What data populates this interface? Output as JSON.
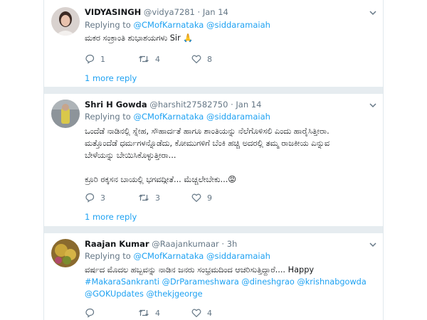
{
  "tweets": [
    {
      "name": "VIDYASINGH",
      "handle": "@vidya7281",
      "dot": "·",
      "time": "Jan 14",
      "replying_label": "Replying to",
      "mention1": "@CMofKarnataka",
      "mention2": "@siddaramaiah",
      "text_line1": "ಮಕರ ಸಂಕ್ರಾಂತಿ ಶುಭಾಶಯಗಳು Sir",
      "emoji": "🙏",
      "reply_count": "1",
      "retweet_count": "4",
      "like_count": "8",
      "more_replies": "1 more reply"
    },
    {
      "name": "Shri H Gowda",
      "handle": "@harshit27582750",
      "dot": "·",
      "time": "Jan 14",
      "replying_label": "Replying to",
      "mention1": "@CMofKarnataka",
      "mention2": "@siddaramaiah",
      "text_line1": "ಒಂದೆಡೆ ನಾಡಿನಲ್ಲಿ ಸ್ನೇಹ, ಸೌಹಾರ್ದತೆ ಹಾಗೂ ಶಾಂತಿಯನ್ನು ನೆಲೆಗೊಳಿಸಲಿ ಎಂದು ಹಾರೈಸಿತ್ತೀರಾ.",
      "text_line2": "ಮತ್ತೊಂದೆಡೆ ಧರ್ಮಗಳನ್ನೊಡೆದು, ಕೋಮುಗಳಿಗೆ ಬೆಂಕಿ ಹಚ್ಚಿ ಅದರಲ್ಲಿ ತಮ್ಮ ರಾಜಕೀಯ ಎನ್ನುವ",
      "text_line3": "ಬೇಳೆಯನ್ನು ಬೇಯಿಸಿಕೊಳ್ಳುತ್ತೀರಾ...",
      "text_line4": "ಕ್ರೂರಿ ರಕ್ಕಸನ ಬಾಯಲ್ಲಿ ಭಗವದ್ಗೀತೆ... ಮೆಚ್ಚಲೇಬೇಕು...",
      "emoji": "😡",
      "reply_count": "3",
      "retweet_count": "3",
      "like_count": "9",
      "more_replies": "1 more reply"
    },
    {
      "name": "Raajan Kumar",
      "handle": "@Raajankumaar",
      "dot": "·",
      "time": "3h",
      "replying_label": "Replying to",
      "mention1": "@CMofKarnataka",
      "mention2": "@siddaramaiah",
      "text_line1": "ವರ್ಷದ ಮೊದಲ ಹಬ್ಬವನ್ನು ನಾಡಿನ ಜನರು ಸಂಭ್ರಮದಿಂದ ಆಚರಿಸುತ್ತಿದ್ದಾರೆ.... Happy",
      "hashtag1": "#MakaraSankranti",
      "tag2": "@DrParameshwara",
      "tag3": "@dineshgrao",
      "tag4": "@krishnabgowda",
      "tag5": "@GOKUpdates",
      "tag6": "@thekjgeorge",
      "reply_count": "",
      "retweet_count": "4",
      "like_count": "4"
    }
  ],
  "colors": {
    "accent": "#1da1f2",
    "muted": "#657786",
    "separator": "#e6ecf0"
  },
  "icons": [
    "reply-icon",
    "retweet-icon",
    "like-icon",
    "caret-down-icon",
    "folded-hands-emoji",
    "angry-face-emoji"
  ]
}
